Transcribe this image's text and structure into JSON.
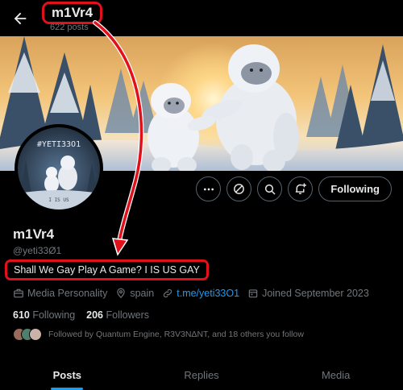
{
  "header": {
    "title": "m1Vr4",
    "posts_count": "622 posts"
  },
  "avatar_text": {
    "top": "#YETI33O1",
    "bottom": "I IS US"
  },
  "actions": {
    "following_label": "Following",
    "icons": [
      "more-icon",
      "ethereum-icon",
      "search-icon",
      "bell-plus-icon"
    ]
  },
  "profile": {
    "display_name": "m1Vr4",
    "handle": "@yeti33Ø1",
    "bio": "Shall We Gay Play A Game? I IS US GAY",
    "category": "Media Personality",
    "location": "spain",
    "link": "t.me/yeti33O1",
    "joined": "Joined September 2023",
    "following_count": "610",
    "following_label": "Following",
    "followers_count": "206",
    "followers_label": "Followers",
    "followed_by": "Followed by Quantum Engine, R3V3NΔNT, and 18 others you follow"
  },
  "tabs": [
    {
      "label": "Posts",
      "active": true
    },
    {
      "label": "Replies",
      "active": false
    },
    {
      "label": "Media",
      "active": false
    }
  ],
  "colors": {
    "annotation_red": "#e0111b",
    "accent": "#1d9bf0",
    "muted": "#71767b"
  }
}
